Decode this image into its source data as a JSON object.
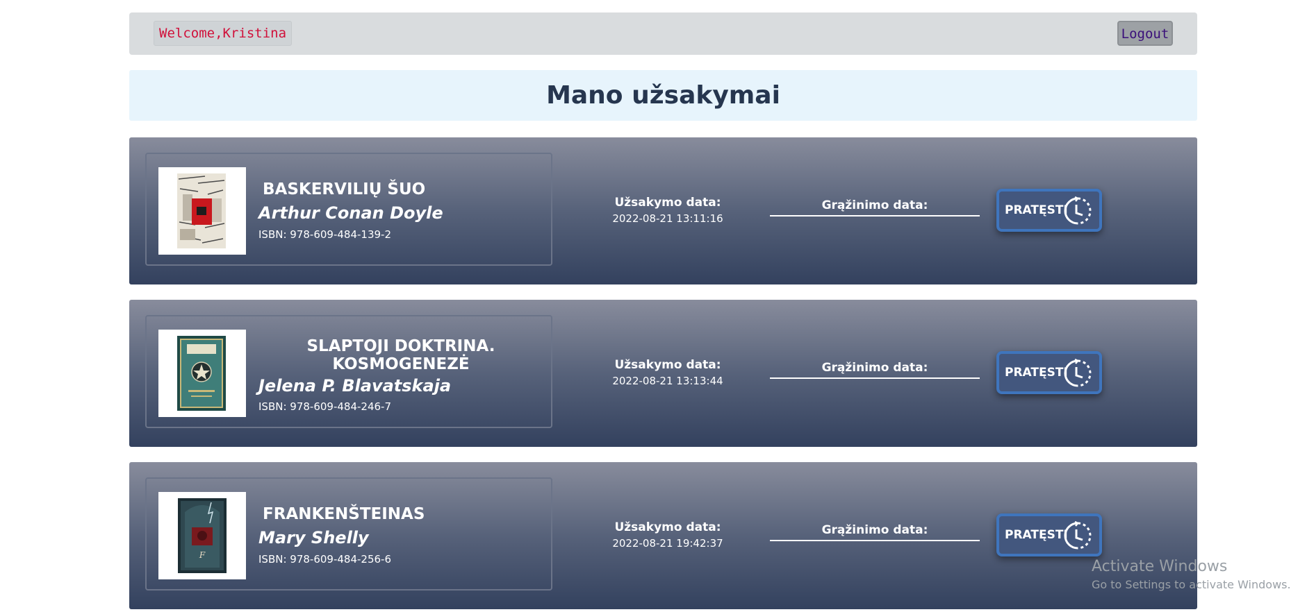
{
  "header": {
    "welcome_text": "Welcome,Kristina",
    "logout_label": "Logout"
  },
  "page": {
    "title": "Mano užsakymai"
  },
  "orders": [
    {
      "title_lines": [
        "BASKERVILIŲ ŠUO"
      ],
      "author": "Arthur Conan Doyle",
      "isbn": "ISBN: 978-609-484-139-2",
      "order_date_label": "Užsakymo data:",
      "order_date": "2022-08-21 13:11:16",
      "return_date_label": "Grąžinimo data:",
      "extend_label": "PRATĘSTI"
    },
    {
      "title_lines": [
        "SLAPTOJI DOKTRINA.",
        "KOSMOGENEZĖ"
      ],
      "author": "Jelena P. Blavatskaja",
      "isbn": "ISBN: 978-609-484-246-7",
      "order_date_label": "Užsakymo data:",
      "order_date": "2022-08-21 13:13:44",
      "return_date_label": "Grąžinimo data:",
      "extend_label": "PRATĘSTI"
    },
    {
      "title_lines": [
        "FRANKENŠTEINAS"
      ],
      "author": "Mary Shelly",
      "isbn": "ISBN: 978-609-484-256-6",
      "order_date_label": "Užsakymo data:",
      "order_date": "2022-08-21 19:42:37",
      "return_date_label": "Grąžinimo data:",
      "extend_label": "PRATĘSTI"
    }
  ],
  "watermark": {
    "line1": "Activate Windows",
    "line2": "Go to Settings to activate Windows."
  },
  "colors": {
    "welcome_text": "#d0103a",
    "logout_text": "#3a0f7a",
    "title_text": "#26364f",
    "card_top": "#888c9c",
    "card_bottom": "#33415e",
    "extend_border": "#3f75bd"
  }
}
